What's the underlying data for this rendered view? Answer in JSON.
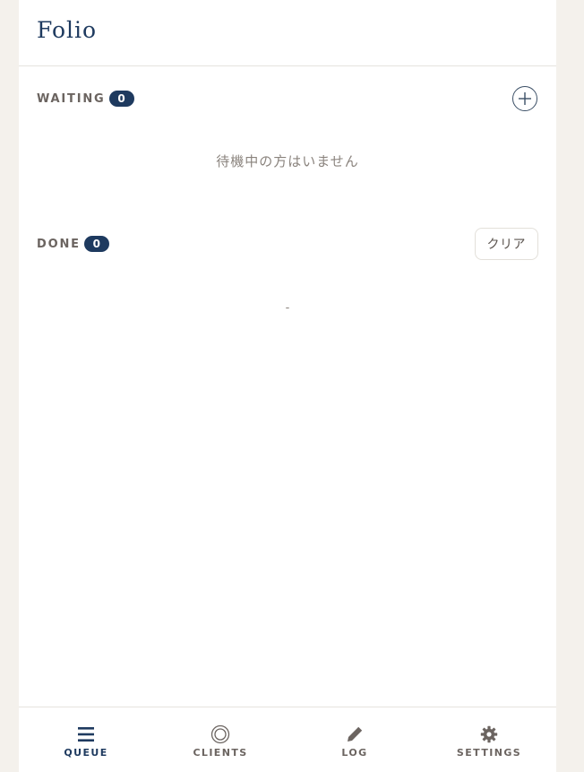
{
  "app": {
    "title": "Folio"
  },
  "waiting": {
    "label": "WAITING",
    "count": "0",
    "empty_text": "待機中の方はいません"
  },
  "done": {
    "label": "DONE",
    "count": "0",
    "clear_label": "クリア",
    "empty_text": "-"
  },
  "nav": {
    "items": [
      {
        "label": "QUEUE",
        "icon": "menu-icon",
        "active": true
      },
      {
        "label": "CLIENTS",
        "icon": "target-icon",
        "active": false
      },
      {
        "label": "LOG",
        "icon": "pencil-icon",
        "active": false
      },
      {
        "label": "SETTINGS",
        "icon": "gear-icon",
        "active": false
      }
    ]
  },
  "colors": {
    "primary": "#1e3a5f",
    "muted_text": "#6b6460",
    "background": "#f4f1ec"
  }
}
